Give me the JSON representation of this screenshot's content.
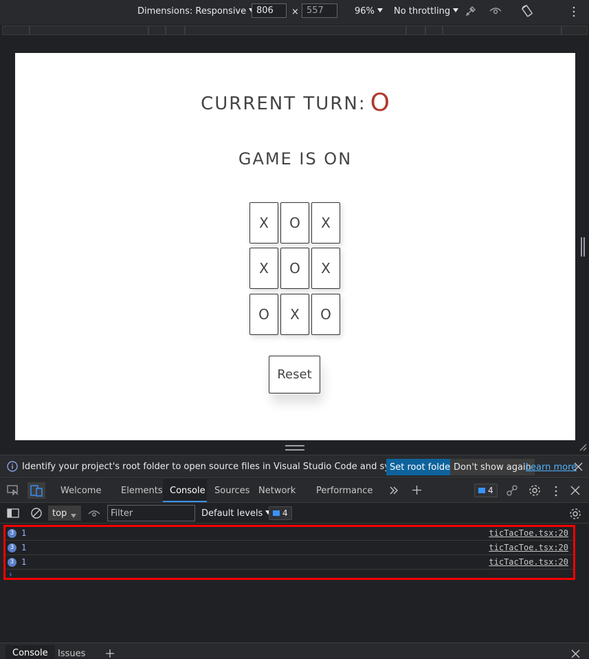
{
  "device_toolbar": {
    "dimensions_label": "Dimensions: Responsive",
    "width": "806",
    "times": "×",
    "height": "557",
    "zoom": "96%",
    "throttling": "No throttling"
  },
  "game": {
    "turn_label": "CURRENT TURN:",
    "turn_value": "O",
    "status": "GAME IS ON",
    "board": [
      "X",
      "O",
      "X",
      "X",
      "O",
      "X",
      "O",
      "X",
      "O"
    ],
    "reset_label": "Reset"
  },
  "infobar": {
    "message": "Identify your project's root folder to open source files in Visual Studio Code and sync changes.",
    "set_root": "Set root folder",
    "dont_show": "Don't show again",
    "learn_more": "Learn more"
  },
  "tabs": {
    "welcome": "Welcome",
    "elements": "Elements",
    "console": "Console",
    "sources": "Sources",
    "network": "Network",
    "performance": "Performance",
    "issues_count": "4"
  },
  "console_toolbar": {
    "context": "top",
    "filter_placeholder": "Filter",
    "levels": "Default levels",
    "message_count": "4"
  },
  "messages": [
    {
      "count": "3",
      "value": "1",
      "source": "ticTacToe.tsx:20"
    },
    {
      "count": "3",
      "value": "1",
      "source": "ticTacToe.tsx:20"
    },
    {
      "count": "3",
      "value": "1",
      "source": "ticTacToe.tsx:20"
    }
  ],
  "prompt": "›",
  "drawer": {
    "console": "Console",
    "issues": "Issues"
  },
  "colors": {
    "accent": "#0e639c",
    "turn_value": "#b03a2e",
    "highlight": "#ff0000"
  }
}
